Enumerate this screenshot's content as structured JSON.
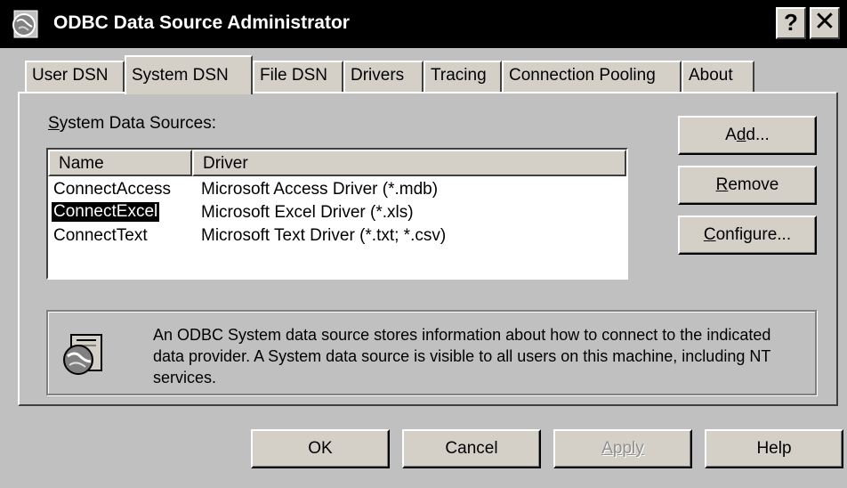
{
  "window": {
    "title": "ODBC Data Source Administrator",
    "help_button": "?",
    "close_button": "✕"
  },
  "tabs": [
    {
      "label": "User DSN",
      "active": false
    },
    {
      "label": "System DSN",
      "active": true
    },
    {
      "label": "File DSN",
      "active": false
    },
    {
      "label": "Drivers",
      "active": false
    },
    {
      "label": "Tracing",
      "active": false
    },
    {
      "label": "Connection Pooling",
      "active": false
    },
    {
      "label": "About",
      "active": false
    }
  ],
  "system_data_sources": {
    "label_mnemonic": "S",
    "label_rest": "ystem Data Sources:",
    "columns": [
      "Name",
      "Driver"
    ],
    "rows": [
      {
        "name": "ConnectAccess",
        "driver": "Microsoft Access Driver (*.mdb)",
        "selected": false
      },
      {
        "name": "ConnectExcel",
        "driver": "Microsoft Excel Driver (*.xls)",
        "selected": true
      },
      {
        "name": "ConnectText",
        "driver": "Microsoft Text Driver (*.txt; *.csv)",
        "selected": false
      }
    ]
  },
  "side_buttons": {
    "add": {
      "pre": "A",
      "mnemonic": "d",
      "post": "d..."
    },
    "remove": {
      "pre": "",
      "mnemonic": "R",
      "post": "emove"
    },
    "configure": {
      "pre": "",
      "mnemonic": "C",
      "post": "onfigure..."
    }
  },
  "info_text": "An ODBC System data source stores information about how to connect to the indicated data provider.  A System data source is visible to all users on this machine, including NT services.",
  "bottom_buttons": {
    "ok": "OK",
    "cancel": "Cancel",
    "apply": "Apply",
    "help": "Help"
  },
  "icons": {
    "title": "odbc-globe-icon",
    "info": "odbc-globe-icon"
  },
  "colors": {
    "dialog_face": "#c0c0c0",
    "titlebar": "#000000",
    "selection": "#000000"
  }
}
